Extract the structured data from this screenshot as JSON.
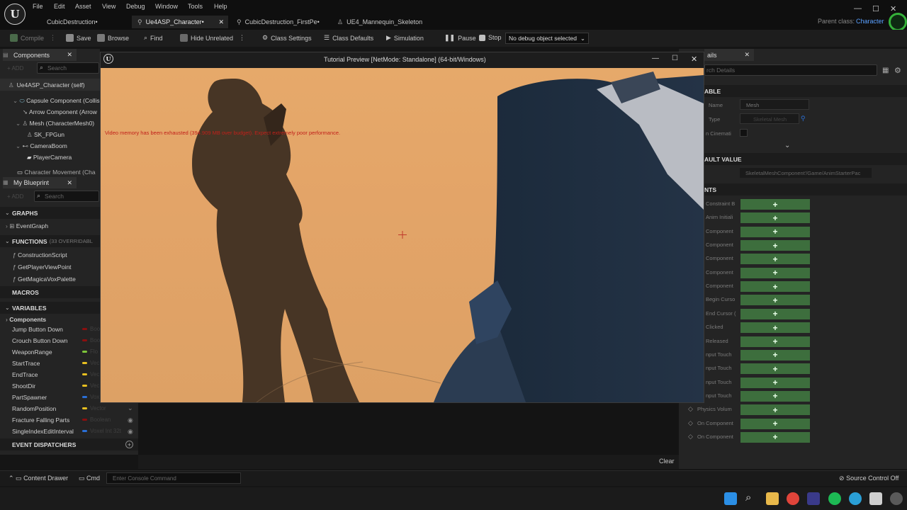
{
  "menu": [
    "File",
    "Edit",
    "Asset",
    "View",
    "Debug",
    "Window",
    "Tools",
    "Help"
  ],
  "tabs": [
    {
      "label": "CubicDestruction•",
      "active": false
    },
    {
      "label": "Ue4ASP_Character•",
      "active": true
    },
    {
      "label": "CubicDestruction_FirstPe•",
      "active": false
    },
    {
      "label": "UE4_Mannequin_Skeleton",
      "active": false
    }
  ],
  "parent_class": {
    "label": "Parent class:",
    "value": "Character"
  },
  "toolbar": {
    "compile": "Compile",
    "save": "Save",
    "browse": "Browse",
    "find": "Find",
    "hide_unrelated": "Hide Unrelated",
    "class_settings": "Class Settings",
    "class_defaults": "Class Defaults",
    "simulation": "Simulation",
    "pause": "Pause",
    "stop": "Stop",
    "debug_select": "No debug object selected"
  },
  "components_panel": {
    "title": "Components",
    "add": "+ ADD",
    "search_placeholder": "Search",
    "items": [
      "Ue4ASP_Character (self)",
      "Capsule Component (Collis",
      "Arrow Component (Arrow",
      "Mesh (CharacterMesh0)",
      "SK_FPGun",
      "CameraBoom",
      "PlayerCamera",
      "Character Movement (Cha"
    ]
  },
  "blueprint_panel": {
    "title": "My Blueprint",
    "add": "+ ADD",
    "search_placeholder": "Search",
    "graphs": "GRAPHS",
    "event_graph": "EventGraph",
    "functions": "FUNCTIONS",
    "functions_note": "(33 OVERRIDABL",
    "function_items": [
      "ConstructionScript",
      "GetPlayerViewPoint",
      "GetMagicaVoxPalette"
    ],
    "macros": "MACROS",
    "variables": "VARIABLES",
    "components_group": "Components",
    "variables_list": [
      {
        "name": "Jump Button Down",
        "type": "Boo",
        "color": "#8b0f0f"
      },
      {
        "name": "Crouch Button Down",
        "type": "Boo",
        "color": "#8b0f0f"
      },
      {
        "name": "WeaponRange",
        "type": "Flo",
        "color": "#7ec63a"
      },
      {
        "name": "StartTrace",
        "type": "Vec",
        "color": "#e8c020"
      },
      {
        "name": "EndTrace",
        "type": "Vec",
        "color": "#e8c020"
      },
      {
        "name": "ShootDir",
        "type": "Vec",
        "color": "#e8c020"
      },
      {
        "name": "PartSpawner",
        "type": "Vox",
        "color": "#2a6fd6"
      },
      {
        "name": "RandomPosition",
        "type": "Vector",
        "color": "#e8c020"
      },
      {
        "name": "Fracture Falling Parts",
        "type": "Boolean",
        "color": "#8b0f0f"
      },
      {
        "name": "SingleIndexEditInterval",
        "type": "Voxel Int 32t",
        "color": "#2a6fd6"
      }
    ],
    "event_dispatchers": "EVENT DISPATCHERS"
  },
  "preview_window": {
    "title": "Tutorial Preview [NetMode: Standalone] (64-bit/Windows)",
    "warning": "Video memory has been exhausted (394.909 MB over budget). Expect extremely poor performance."
  },
  "details_panel": {
    "tab": "ails",
    "search_placeholder": "rch Details",
    "variable_header": "ABLE",
    "name_label": "Name",
    "name_value": "Mesh",
    "type_label": "Type",
    "type_value": "Skeletal Mesh",
    "cinematic_label": "n Cinemati",
    "default_header": "AULT VALUE",
    "default_value": "SkeletalMeshComponent'/Game/AnimStarterPac",
    "events_header": "NTS",
    "event_rows": [
      "Constraint B",
      "Anim Initiali",
      "Component",
      "Component",
      "Component",
      "Component",
      "Component",
      "Begin Curso",
      "End Cursor (",
      "Clicked",
      "Released",
      "nput Touch",
      "nput Touch",
      "nput Touch",
      "nput Touch",
      "Physics Volum",
      "On Component",
      "On Component"
    ]
  },
  "output": {
    "clear": "Clear"
  },
  "bottombar": {
    "content_drawer": "Content Drawer",
    "cmd": "Cmd",
    "console_placeholder": "Enter Console Command",
    "source_control": "Source Control Off"
  }
}
